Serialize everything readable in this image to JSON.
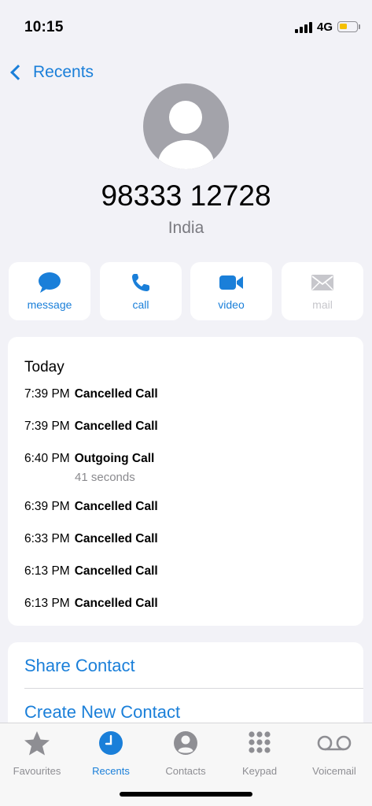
{
  "status_bar": {
    "time": "10:15",
    "network": "4G",
    "battery_level": 0.45,
    "battery_color": "#f5c000"
  },
  "nav": {
    "back_label": "Recents"
  },
  "contact": {
    "number": "98333 12728",
    "location": "India"
  },
  "actions": [
    {
      "label": "message",
      "icon": "message-bubble-icon",
      "enabled": true
    },
    {
      "label": "call",
      "icon": "phone-icon",
      "enabled": true
    },
    {
      "label": "video",
      "icon": "video-camera-icon",
      "enabled": true
    },
    {
      "label": "mail",
      "icon": "envelope-icon",
      "enabled": false
    }
  ],
  "history": {
    "header": "Today",
    "calls": [
      {
        "time": "7:39 PM",
        "type": "Cancelled Call"
      },
      {
        "time": "7:39 PM",
        "type": "Cancelled Call"
      },
      {
        "time": "6:40 PM",
        "type": "Outgoing Call",
        "duration": "41 seconds"
      },
      {
        "time": "6:39 PM",
        "type": "Cancelled Call"
      },
      {
        "time": "6:33 PM",
        "type": "Cancelled Call"
      },
      {
        "time": "6:13 PM",
        "type": "Cancelled Call"
      },
      {
        "time": "6:13 PM",
        "type": "Cancelled Call"
      }
    ]
  },
  "options": {
    "share_contact": "Share Contact",
    "create_new_contact": "Create New Contact"
  },
  "tabs": [
    {
      "label": "Favourites",
      "icon": "star-icon",
      "active": false
    },
    {
      "label": "Recents",
      "icon": "clock-icon",
      "active": true
    },
    {
      "label": "Contacts",
      "icon": "contact-person-icon",
      "active": false
    },
    {
      "label": "Keypad",
      "icon": "keypad-icon",
      "active": false
    },
    {
      "label": "Voicemail",
      "icon": "voicemail-icon",
      "active": false
    }
  ],
  "colors": {
    "accent": "#1a7fd9",
    "inactive": "#8e8e93",
    "background": "#f2f2f7"
  }
}
